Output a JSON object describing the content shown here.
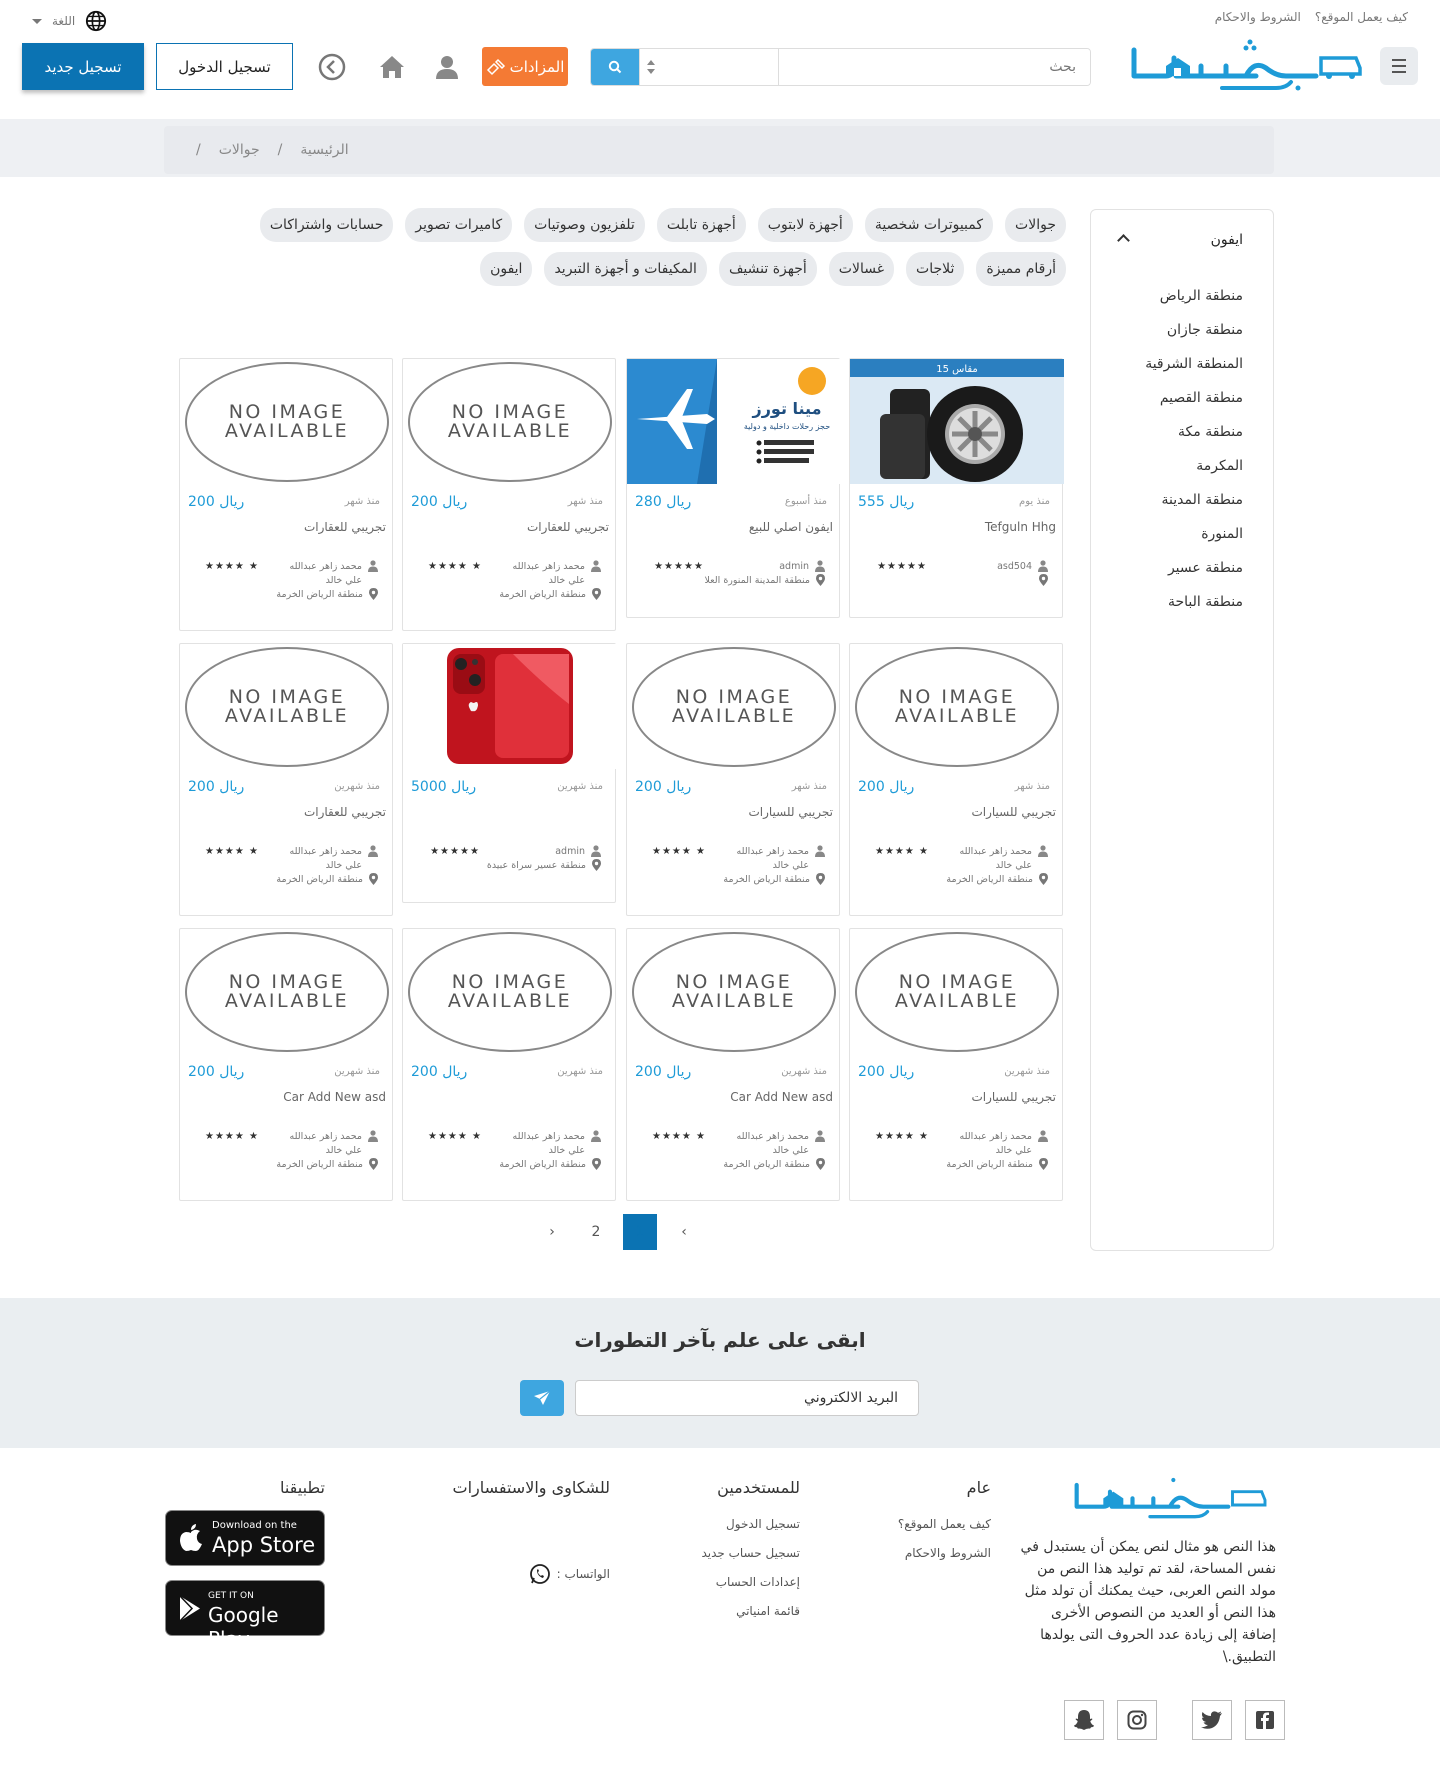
{
  "top": {
    "links": [
      "كيف يعمل الموقع؟",
      "الشروط والاحكام"
    ],
    "language_label": "اللغة"
  },
  "header": {
    "search_placeholder": "بحث",
    "auction_label": "المزادات",
    "login_label": "تسجيل الدخول",
    "register_label": "تسجيل جديد",
    "logo_text": "مستعمل.كوم",
    "brand_color": "#1e9bd7",
    "accent_color": "#0b73b3",
    "auction_color": "#f47a34"
  },
  "breadcrumb": [
    "الرئيسية",
    "جوالات",
    ""
  ],
  "sidebar": {
    "title": "ايفون",
    "items": [
      "منطقة الرياض",
      "منطقة جازان",
      "المنطقة الشرقية",
      "منطقة القصيم",
      "منطقة مكة",
      "المكرمة",
      "منطقة المدينة",
      "المنورة",
      "منطقة عسير",
      "منطقة الباحة"
    ]
  },
  "categories": [
    "جوالات",
    "كمبيوترات شخصية",
    "أجهزة لابتوب",
    "أجهزة تابلت",
    "تلفزيون وصوتيات",
    "كاميرات تصوير",
    "حسابات واشتراكات",
    "أرقام مميزة",
    "ثلاجات",
    "غسالات",
    "أجهزة تنشيف",
    "المكيفات و أجهزة التبريد",
    "ايفون"
  ],
  "no_image_text": [
    "NO IMAGE",
    "AVAILABLE"
  ],
  "currency": "ريال",
  "listings": [
    {
      "image": "tires",
      "image_text": "مقاس 15",
      "price": "555",
      "time": "منذ يوم",
      "title": "Tefguln Hhg",
      "user": "asd504",
      "user2": "",
      "stars": "★★★★★",
      "location": ""
    },
    {
      "image": "travel",
      "image_text": "مينا تورز",
      "image_sub": "حجز رحلات داخلية و دولية",
      "price": "280",
      "time": "منذ أسبوع",
      "title": "ايفون اصلي للبيع",
      "user": "admin",
      "user2": "",
      "stars": "★★★★★",
      "location": "منطقة المدينة المنورة العلا"
    },
    {
      "image": "none",
      "price": "200",
      "time": "منذ شهر",
      "title": "تجريبي للعقارات",
      "user": "محمد زاهر عبدالله",
      "user2": "علي خالد",
      "stars": "★★★★ ★",
      "location": "منطقة الرياض الخرمة"
    },
    {
      "image": "none",
      "price": "200",
      "time": "منذ شهر",
      "title": "تجريبي للعقارات",
      "user": "محمد زاهر عبدالله",
      "user2": "علي خالد",
      "stars": "★★★★ ★",
      "location": "منطقة الرياض الخرمة"
    },
    {
      "image": "none",
      "price": "200",
      "time": "منذ شهر",
      "title": "تجريبي للسيارات",
      "user": "محمد زاهر عبدالله",
      "user2": "علي خالد",
      "stars": "★★★★ ★",
      "location": "منطقة الرياض الخرمة"
    },
    {
      "image": "none",
      "price": "200",
      "time": "منذ شهر",
      "title": "تجريبي للسيارات",
      "user": "محمد زاهر عبدالله",
      "user2": "علي خالد",
      "stars": "★★★★ ★",
      "location": "منطقة الرياض الخرمة"
    },
    {
      "image": "iphone",
      "price": "5000",
      "time": "منذ شهرين",
      "title": "",
      "user": "admin",
      "user2": "",
      "stars": "★★★★★",
      "location": "منطقة عسير سراة عبيدة"
    },
    {
      "image": "none",
      "price": "200",
      "time": "منذ شهرين",
      "title": "تجريبي للعقارات",
      "user": "محمد زاهر عبدالله",
      "user2": "علي خالد",
      "stars": "★★★★ ★",
      "location": "منطقة الرياض الخرمة"
    },
    {
      "image": "none",
      "price": "200",
      "time": "منذ شهرين",
      "title": "تجريبي للسيارات",
      "user": "محمد زاهر عبدالله",
      "user2": "علي خالد",
      "stars": "★★★★ ★",
      "location": "منطقة الرياض الخرمة"
    },
    {
      "image": "none",
      "price": "200",
      "time": "منذ شهرين",
      "title": "Car Add New asd",
      "user": "محمد زاهر عبدالله",
      "user2": "علي خالد",
      "stars": "★★★★ ★",
      "location": "منطقة الرياض الخرمة"
    },
    {
      "image": "none",
      "price": "200",
      "time": "منذ شهرين",
      "title": "",
      "user": "محمد زاهر عبدالله",
      "user2": "علي خالد",
      "stars": "★★★★ ★",
      "location": "منطقة الرياض الخرمة"
    },
    {
      "image": "none",
      "price": "200",
      "time": "منذ شهرين",
      "title": "Car Add New asd",
      "user": "محمد زاهر عبدالله",
      "user2": "علي خالد",
      "stars": "★★★★ ★",
      "location": "منطقة الرياض الخرمة"
    }
  ],
  "pagination": {
    "prev": "‹",
    "pages": [
      "1",
      "2"
    ],
    "next": "›",
    "current": "1"
  },
  "newsletter": {
    "title": "ابقى على علم بآخر التطورات",
    "placeholder": "البريد الالكتروني"
  },
  "footer": {
    "about": "هذا النص هو مثال لنص يمكن أن يستبدل في نفس المساحة، لقد تم توليد هذا النص من مولد النص العربى، حيث يمكنك أن تولد مثل هذا النص أو العديد من النصوص الأخرى إضافة إلى زيادة عدد الحروف التى يولدها التطبيق.\\",
    "general": {
      "title": "عام",
      "links": [
        "كيف يعمل الموقع؟",
        "الشروط والاحكام"
      ]
    },
    "users": {
      "title": "للمستخدمين",
      "links": [
        "تسجيل الدخول",
        "تسجيل حساب جديد",
        "إعدادات الحساب",
        "قائمة امنياتي"
      ]
    },
    "complaints": {
      "title": "للشكاوى والاستفسارات",
      "whatsapp": "الواتساب :"
    },
    "apps": {
      "title": "تطبيقنا",
      "appstore_small": "Download on the",
      "appstore_big": "App Store",
      "gplay_small": "GET IT ON",
      "gplay_big": "Google Play"
    },
    "social": [
      "facebook-icon",
      "twitter-icon",
      "instagram-icon",
      "snapchat-icon"
    ]
  }
}
